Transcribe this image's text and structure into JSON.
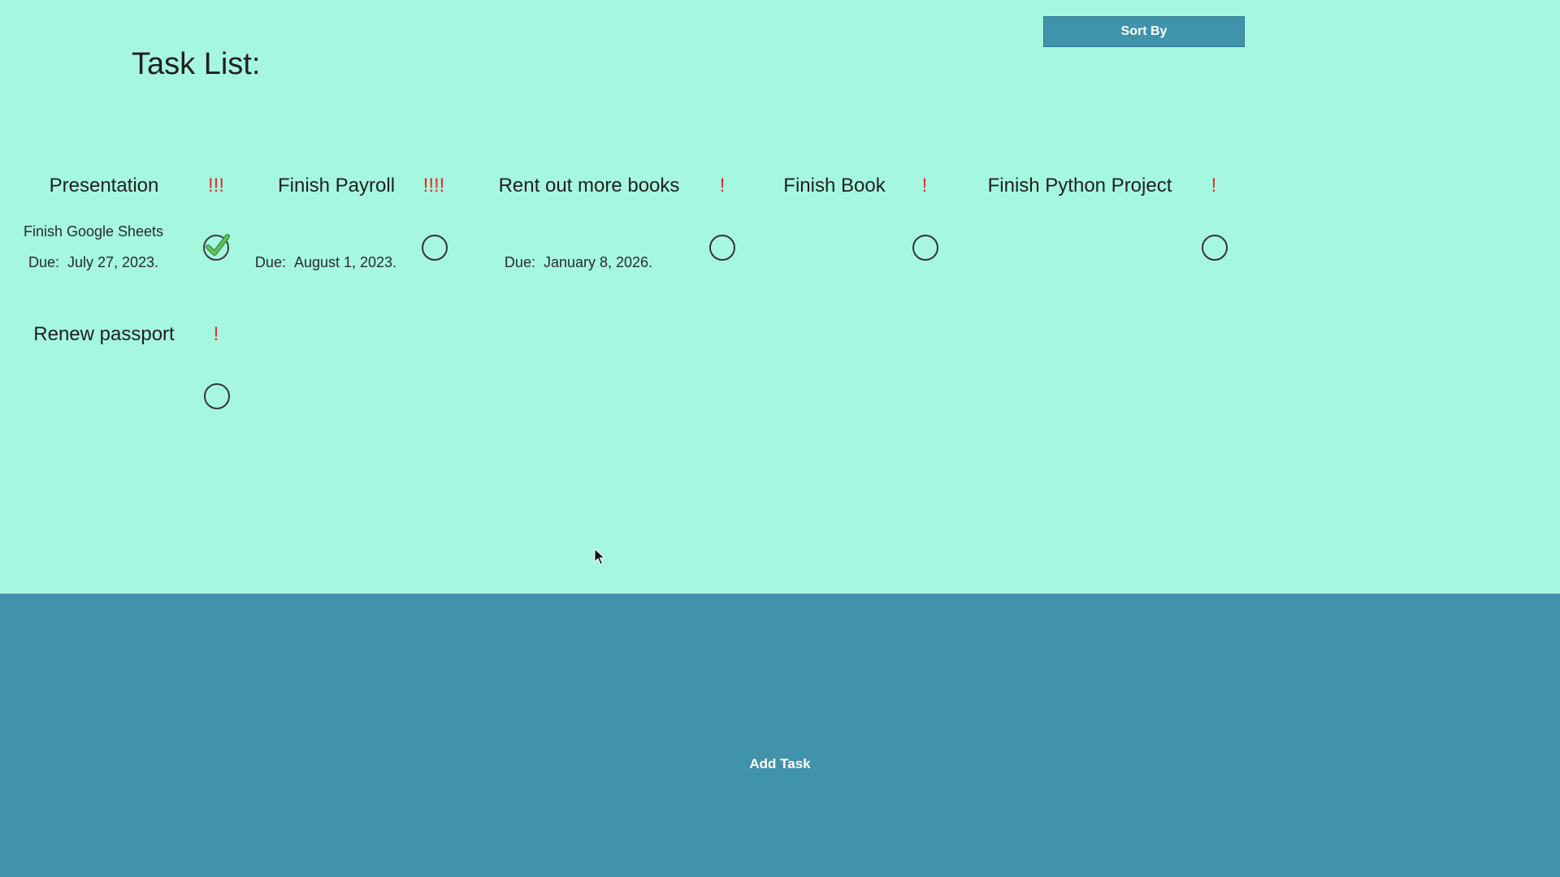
{
  "header": {
    "title": "Task List:",
    "sort_label": "Sort By"
  },
  "tasks": [
    {
      "title": "Presentation",
      "priority": "!!!",
      "description": "Finish Google Sheets",
      "due_label": "Due:",
      "due_date": "July 27, 2023.",
      "completed": true
    },
    {
      "title": "Finish Payroll",
      "priority": "!!!!",
      "description": "",
      "due_label": "Due:",
      "due_date": "August 1, 2023.",
      "completed": false
    },
    {
      "title": "Rent out more books",
      "priority": "!",
      "description": "",
      "due_label": "Due:",
      "due_date": "January 8, 2026.",
      "completed": false
    },
    {
      "title": "Finish Book",
      "priority": "!",
      "description": "",
      "due_label": "",
      "due_date": "",
      "completed": false
    },
    {
      "title": "Finish Python Project",
      "priority": "!",
      "description": "",
      "due_label": "",
      "due_date": "",
      "completed": false
    },
    {
      "title": "Renew passport",
      "priority": "!",
      "description": "",
      "due_label": "",
      "due_date": "",
      "completed": false
    }
  ],
  "footer": {
    "add_task_label": "Add Task"
  },
  "colors": {
    "background": "#a6f7e0",
    "panel": "#4192ab",
    "priority": "#e52a2a",
    "check": "#4caf50"
  }
}
